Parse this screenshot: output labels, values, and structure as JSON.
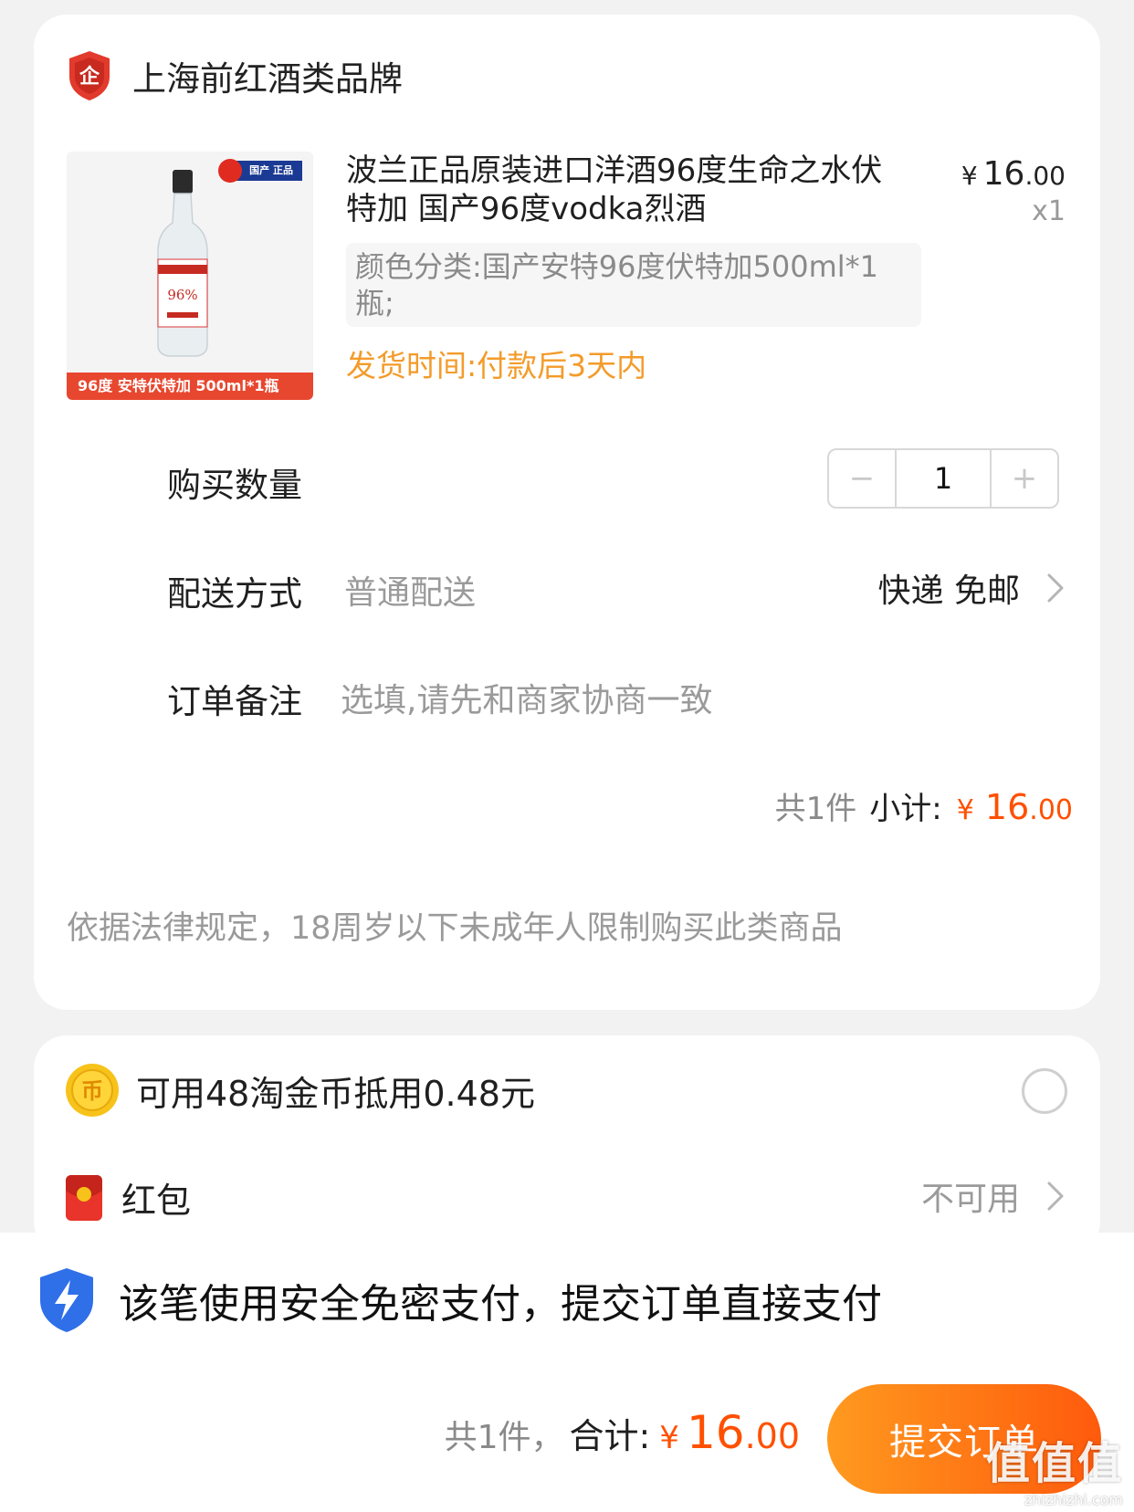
{
  "shop": {
    "name": "上海前红酒类品牌",
    "badge_char": "企"
  },
  "product": {
    "title": "波兰正品原装进口洋酒96度生命之水伏特加 国产96度vodka烈酒",
    "price_symbol": "¥",
    "price_int": "16",
    "price_dec": ".00",
    "quantity": "x1",
    "sku": "颜色分类:国产安特96度伏特加500ml*1瓶;",
    "ship_time": "发货时间:付款后3天内",
    "image_tag": "96度 安特伏特加 500ml*1瓶",
    "image_flag": "国产 正品",
    "bottle_label": "96%"
  },
  "purchase_qty": {
    "label": "购买数量",
    "value": "1",
    "minus": "−",
    "plus": "+"
  },
  "delivery": {
    "label": "配送方式",
    "value": "普通配送",
    "detail": "快递 免邮"
  },
  "note": {
    "label": "订单备注",
    "placeholder": "选填,请先和商家协商一致"
  },
  "subtotal": {
    "count": "共1件",
    "label": "小计:",
    "symbol": "¥",
    "int": "16",
    "dec": ".00"
  },
  "legal": "依据法律规定，18周岁以下未成年人限制购买此类商品",
  "coins": {
    "text": "可用48淘金币抵用0.48元",
    "icon_char": "币"
  },
  "hongbao": {
    "label": "红包",
    "status": "不可用"
  },
  "secure": {
    "text": "该笔使用安全免密支付，提交订单直接支付"
  },
  "total": {
    "count": "共1件，",
    "label": "合计:",
    "symbol": "¥",
    "int": "16",
    "dec": ".00"
  },
  "submit": {
    "label": "提交订单"
  },
  "watermark": {
    "main": "值值值",
    "sub": "zhizhizhi.com"
  },
  "colors": {
    "accent": "#ff5000",
    "ship_time": "#f39b2a",
    "button_start": "#ff9a1f",
    "button_end": "#ff5a0c"
  }
}
